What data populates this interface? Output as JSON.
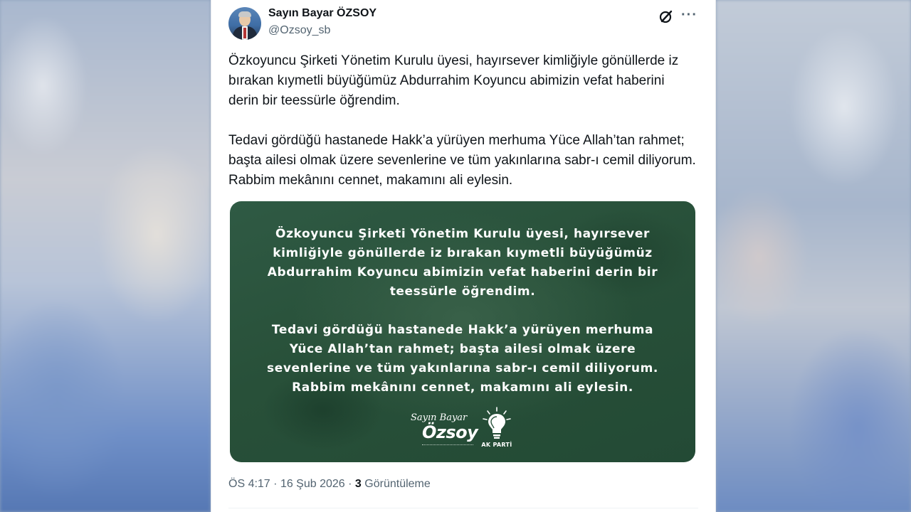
{
  "author": {
    "display_name": "Sayın Bayar ÖZSOY",
    "handle": "@Ozsoy_sb"
  },
  "icons": {
    "grok": "grok-icon",
    "more": "more-options-icon",
    "more_glyph": "···"
  },
  "tweet": {
    "paragraphs": [
      "Özkoyuncu Şirketi Yönetim Kurulu üyesi, hayırsever kimliğiyle gönüllerde iz bırakan kıymetli büyüğümüz Abdurrahim Koyuncu abimizin vefat haberini derin bir teessürle öğrendim.",
      "Tedavi gördüğü hastanede Hakk’a yürüyen merhuma Yüce Allah’tan rahmet; başta ailesi olmak üzere sevenlerine ve tüm yakınlarına sabr-ı cemil diliyorum. Rabbim mekânını cennet, makamını ali eylesin."
    ]
  },
  "media": {
    "lines_p1": [
      "Özkoyuncu Şirketi Yönetim Kurulu üyesi, hayırsever",
      "kimliğiyle gönüllerde iz bırakan kıymetli büyüğümüz",
      "Abdurrahim Koyuncu abimizin vefat haberini derin bir",
      "teessürle öğrendim."
    ],
    "lines_p2": [
      "Tedavi gördüğü hastanede Hakk’a yürüyen merhuma",
      "Yüce Allah’tan rahmet; başta ailesi olmak üzere",
      "sevenlerine ve tüm yakınlarına sabr-ı cemil diliyorum.",
      "Rabbim mekânını cennet, makamını ali eylesin."
    ],
    "signature_script": "Sayın Bayar",
    "signature_name": "Özsoy",
    "party_label": "AK PARTİ",
    "background_color": "#2b543d"
  },
  "meta": {
    "time": "ÖS 4:17",
    "separator": "·",
    "date": "16 Şub 2026",
    "views_count": "3",
    "views_label": "Görüntüleme"
  },
  "colors": {
    "text_primary": "#0f1419",
    "text_secondary": "#536471"
  }
}
